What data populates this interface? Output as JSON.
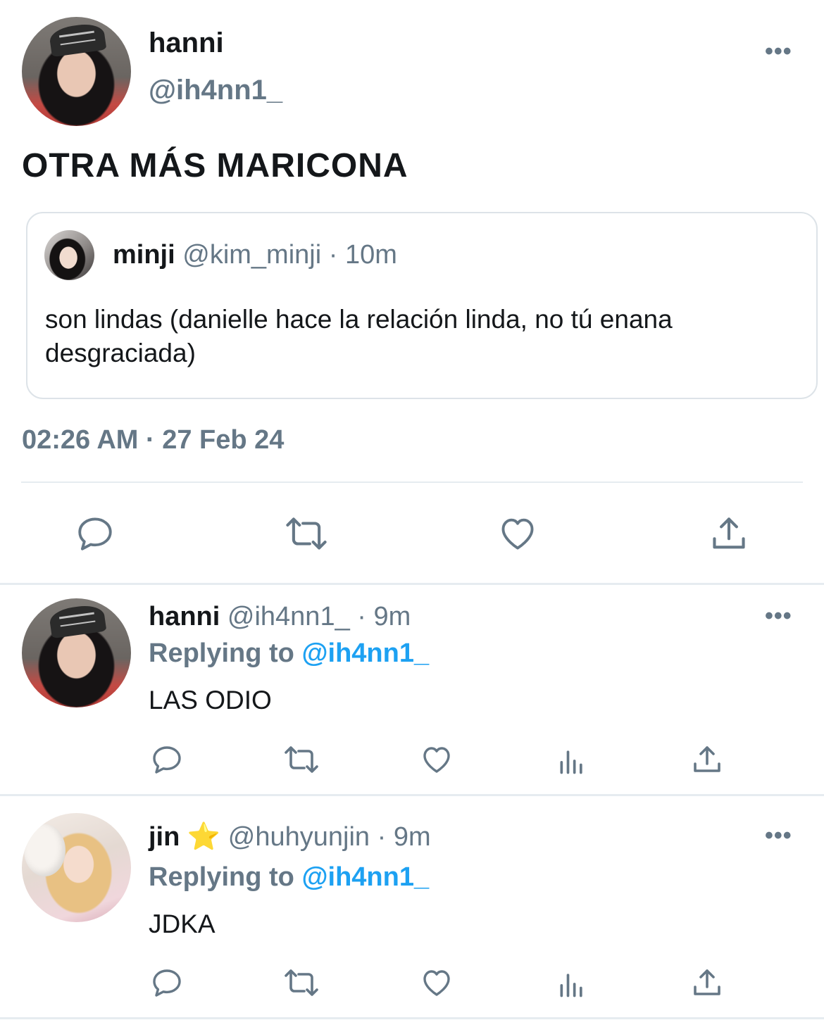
{
  "main_tweet": {
    "display_name": "hanni",
    "handle": "@ih4nn1_",
    "text": "OTRA MÁS MARICONA",
    "timestamp": "02:26 AM · 27 Feb 24",
    "more_icon": "more-dots-icon"
  },
  "quoted_tweet": {
    "display_name": "minji",
    "handle": "@kim_minji",
    "time": "· 10m",
    "text": "son lindas (danielle hace la relación linda, no tú enana desgraciada)"
  },
  "replies": [
    {
      "display_name": "hanni",
      "handle": "@ih4nn1_",
      "time": "· 9m",
      "replying_prefix": "Replying to",
      "replying_handle": "@ih4nn1_",
      "text": "LAS ODIO"
    },
    {
      "display_name": "jin",
      "badge_emoji": "⭐",
      "handle": "@huhyunjin",
      "time": "· 9m",
      "replying_prefix": "Replying to",
      "replying_handle": "@ih4nn1_",
      "text": "JDKA"
    }
  ],
  "colors": {
    "text": "#14171a",
    "secondary": "#657786",
    "link": "#1da1f2",
    "divider": "#e6ecf0"
  },
  "icons": [
    "reply-icon",
    "retweet-icon",
    "like-icon",
    "views-icon",
    "share-icon"
  ]
}
